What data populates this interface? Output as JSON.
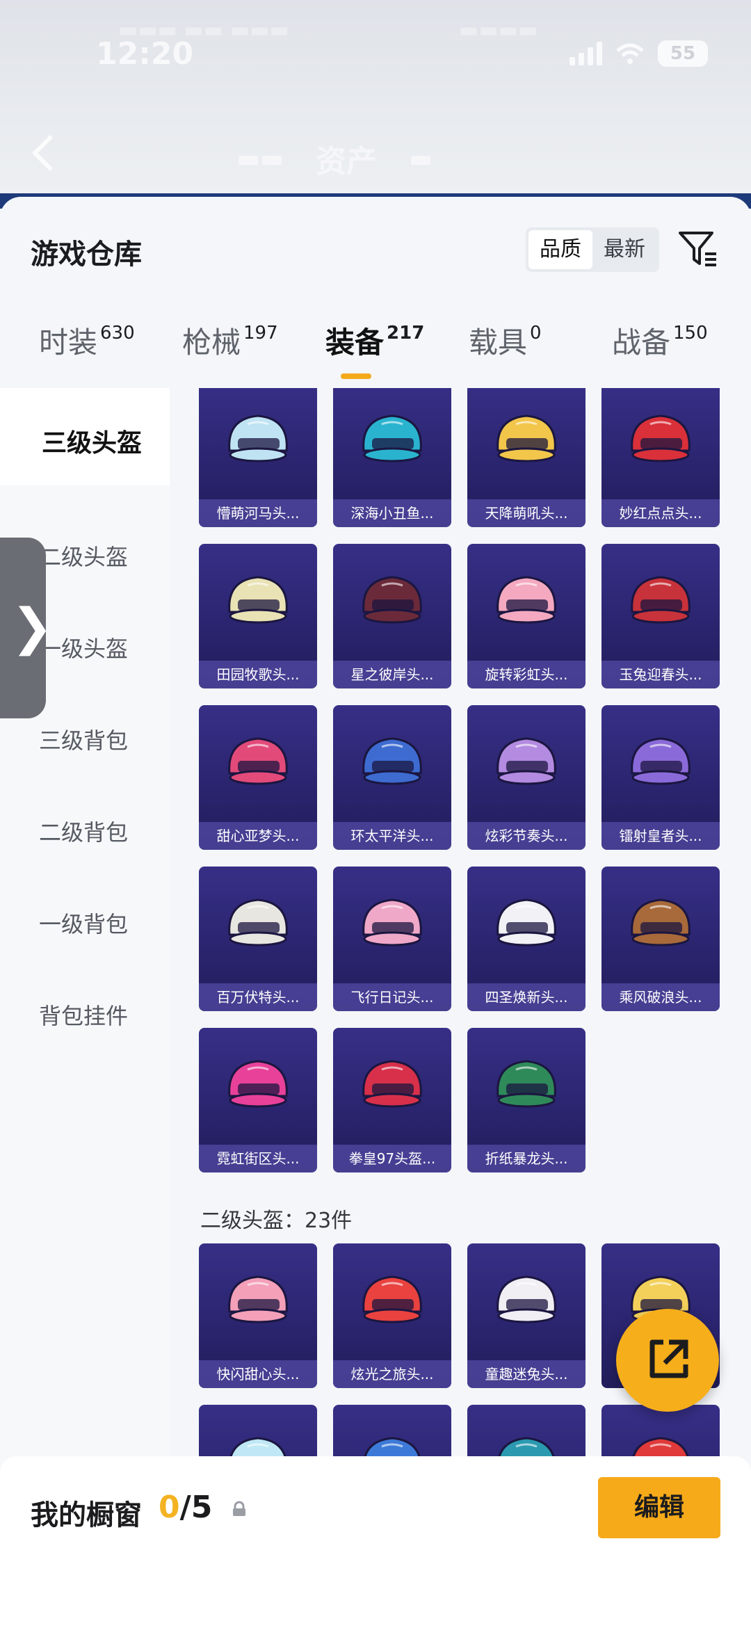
{
  "status_bar": {
    "time": "12:20",
    "battery": "55"
  },
  "header": {
    "tabs": [
      "资产"
    ],
    "active_tab": "资产"
  },
  "sheet": {
    "title": "游戏仓库",
    "sort_options": [
      "品质",
      "最新"
    ],
    "active_sort": "品质"
  },
  "category_tabs": [
    {
      "label": "时装",
      "count": "630"
    },
    {
      "label": "枪械",
      "count": "197"
    },
    {
      "label": "装备",
      "count": "217"
    },
    {
      "label": "载具",
      "count": "0"
    },
    {
      "label": "战备",
      "count": "150"
    }
  ],
  "active_category": "装备",
  "side_items": [
    "三级头盔",
    "二级头盔",
    "一级头盔",
    "三级背包",
    "二级背包",
    "一级背包",
    "背包挂件"
  ],
  "active_side_item": "三级头盔",
  "level3_items": [
    {
      "name": "懵萌河马头...",
      "color": "#bfe3f2"
    },
    {
      "name": "深海小丑鱼...",
      "color": "#2ab3cf"
    },
    {
      "name": "天降萌吼头...",
      "color": "#f2c64a"
    },
    {
      "name": "妙红点点头...",
      "color": "#d9303a"
    },
    {
      "name": "田园牧歌头...",
      "color": "#e9e2b4"
    },
    {
      "name": "星之彼岸头...",
      "color": "#6b2a3a"
    },
    {
      "name": "旋转彩虹头...",
      "color": "#f4a9c0"
    },
    {
      "name": "玉兔迎春头...",
      "color": "#c8323a"
    },
    {
      "name": "甜心亚梦头...",
      "color": "#e24a7a"
    },
    {
      "name": "环太平洋头...",
      "color": "#3d6bd0"
    },
    {
      "name": "炫彩节奏头...",
      "color": "#b38be0"
    },
    {
      "name": "镭射皇者头...",
      "color": "#8a6ad8"
    },
    {
      "name": "百万伏特头...",
      "color": "#e8e6e0"
    },
    {
      "name": "飞行日记头...",
      "color": "#f0a8c8"
    },
    {
      "name": "四圣焕新头...",
      "color": "#f2f2f6"
    },
    {
      "name": "乘风破浪头...",
      "color": "#a86a3a"
    },
    {
      "name": "霓虹街区头...",
      "color": "#e8419a"
    },
    {
      "name": "拳皇97头盔...",
      "color": "#d8304a"
    },
    {
      "name": "折纸暴龙头...",
      "color": "#2f8a5a"
    }
  ],
  "level2_section": {
    "title": "二级头盔：23件"
  },
  "level2_items": [
    {
      "name": "快闪甜心头...",
      "color": "#f3a0b8"
    },
    {
      "name": "炫光之旅头...",
      "color": "#e9423f"
    },
    {
      "name": "童趣迷兔头...",
      "color": "#f1eef4"
    },
    {
      "name": "",
      "color": "#f3d05a"
    },
    {
      "name": "",
      "color": "#bfe8f4"
    },
    {
      "name": "",
      "color": "#3d7ad8"
    },
    {
      "name": "",
      "color": "#2b9ab0"
    },
    {
      "name": "",
      "color": "#e03a3a"
    }
  ],
  "bottom_bar": {
    "window_label": "我的橱窗",
    "window_used": "0",
    "window_total": "/5",
    "edit_label": "编辑"
  }
}
